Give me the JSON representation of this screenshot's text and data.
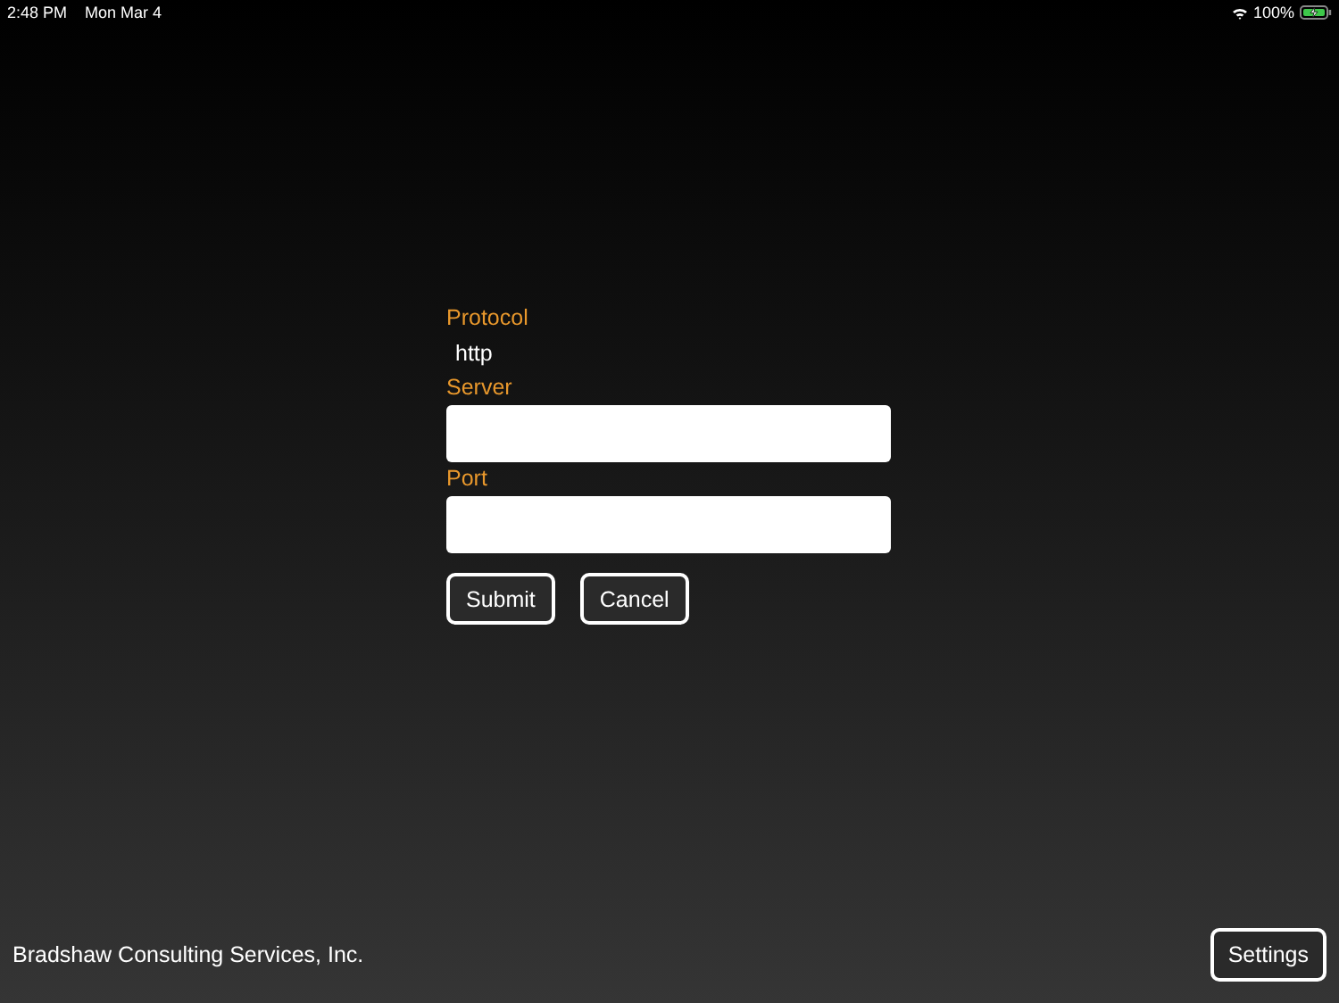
{
  "status_bar": {
    "time": "2:48 PM",
    "date": "Mon Mar 4",
    "battery": "100%",
    "charging": true
  },
  "form": {
    "fields": [
      {
        "kind": "text",
        "label": "Protocol",
        "value": "http"
      },
      {
        "kind": "input",
        "label": "Server"
      },
      {
        "kind": "input",
        "label": "Port"
      }
    ],
    "buttons": [
      "Submit",
      "Cancel"
    ]
  },
  "footer": {
    "company": "Bradshaw Consulting Services, Inc.",
    "button": "Settings"
  }
}
